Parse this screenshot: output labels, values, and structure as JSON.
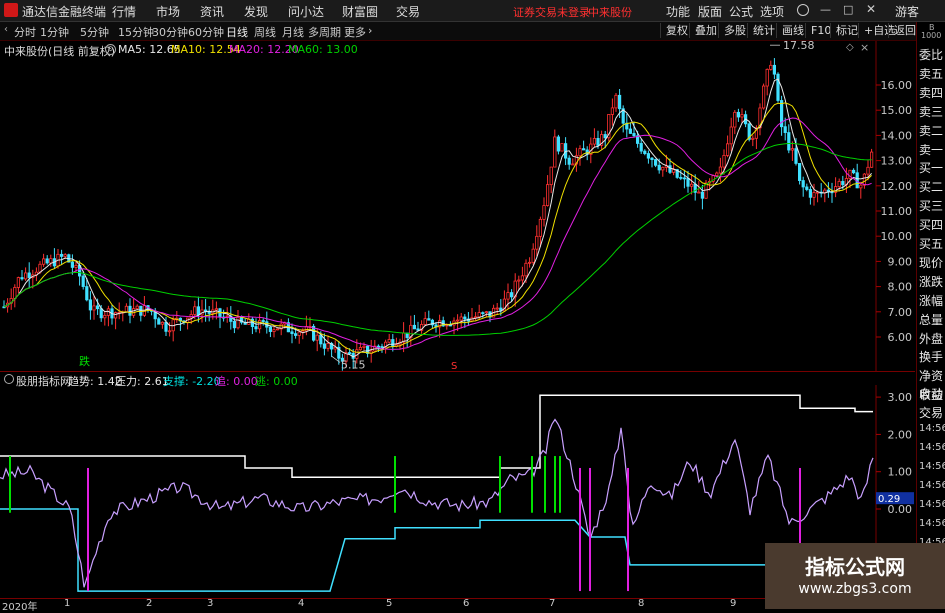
{
  "titlebar": {
    "app_name": "通达信金融终端",
    "menus": [
      "行情",
      "市场",
      "资讯",
      "发现",
      "问小达",
      "财富圈",
      "交易"
    ],
    "notice": "证券交易未登录",
    "notice2": "中来股份",
    "right_menus": [
      "功能",
      "版面",
      "公式",
      "选项"
    ],
    "user": "游客"
  },
  "toolbar": {
    "periods": [
      "分时",
      "1分钟",
      "5分钟",
      "15分钟",
      "30分钟",
      "60分钟",
      "日线",
      "周线",
      "月线",
      "多周期",
      "更多"
    ],
    "active_period": "日线",
    "right_buttons": [
      "复权",
      "叠加",
      "多股",
      "统计",
      "画线",
      "F10",
      "标记",
      "+自选",
      "返回"
    ]
  },
  "main": {
    "stock_title": "中来股份(日线 前复权)",
    "ma": [
      {
        "label": "MA5: 12.65",
        "color": "#e8e8e8"
      },
      {
        "label": "MA10: 12.54",
        "color": "#f0e000"
      },
      {
        "label": "MA20: 12.20",
        "color": "#e020e0"
      },
      {
        "label": "MA60: 13.00",
        "color": "#00d000"
      }
    ],
    "high_label": "17.58",
    "low_label": "5.15",
    "y_ticks": [
      "16.00",
      "15.00",
      "14.00",
      "13.00",
      "12.00",
      "11.00",
      "10.00",
      "9.00",
      "8.00",
      "7.00",
      "6.00"
    ],
    "marker_fall": "跌",
    "marker_s": "S"
  },
  "sub": {
    "indicator_name": "股朋指标网",
    "values": [
      {
        "label": "趋势: 1.42",
        "color": "#e8e8e8"
      },
      {
        "label": "压力: 2.61",
        "color": "#e8e8e8"
      },
      {
        "label": "支撑: -2.20",
        "color": "#00e0e0"
      },
      {
        "label": "追: 0.00",
        "color": "#e020e0"
      },
      {
        "label": "逃: 0.00",
        "color": "#00d000"
      }
    ],
    "y_ticks": [
      "3.00",
      "2.00",
      "1.00",
      "0.00"
    ],
    "current_value": "0.29"
  },
  "xaxis": {
    "labels": [
      "2020年",
      "1",
      "2",
      "3",
      "4",
      "5",
      "6",
      "7",
      "8",
      "9"
    ]
  },
  "rightpanel": {
    "items": [
      "委比",
      "卖五",
      "卖四",
      "卖三",
      "卖二",
      "卖一",
      "买一",
      "买二",
      "买三",
      "买四",
      "买五",
      "现价",
      "涨跌",
      "涨幅",
      "总量",
      "外盘",
      "换手",
      "净资",
      "收益",
      "自动",
      "交易",
      "14:56",
      "14:56",
      "14:56",
      "14:56",
      "14:56",
      "14:56",
      "14:56"
    ],
    "top_labels": [
      "B",
      "1000"
    ]
  },
  "watermark": {
    "line1": "指标公式网",
    "line2": "www.zbgs3.com"
  },
  "colors": {
    "up": "#ff3030",
    "down": "#40e0ff",
    "ma5": "#e8e8e8",
    "ma10": "#f0e000",
    "ma20": "#e020e0",
    "ma60": "#00d000",
    "trend": "#c8a0ff",
    "pressure": "#ffffff",
    "support": "#40e0ff"
  }
}
